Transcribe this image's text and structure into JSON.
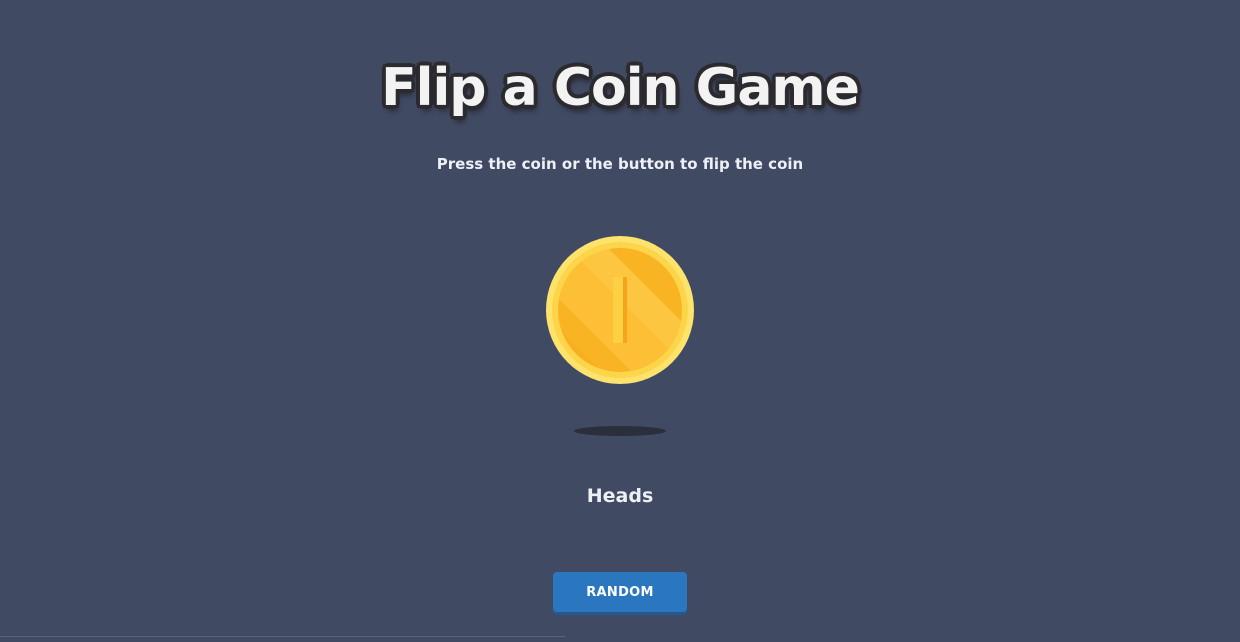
{
  "header": {
    "title": "Flip a Coin Game",
    "subtitle": "Press the coin or the button to flip the coin"
  },
  "coin": {
    "face": "heads",
    "icon": "coin-icon",
    "colors": {
      "rim": "#fde36c",
      "face": "#fcc02c",
      "face_dark": "#f7a91d",
      "mark": "#fdd143"
    }
  },
  "result": {
    "text": "Heads"
  },
  "controls": {
    "random_label": "RANDOM"
  },
  "colors": {
    "background": "#414a63",
    "button": "#2a77c0",
    "text": "#eef0f6"
  }
}
